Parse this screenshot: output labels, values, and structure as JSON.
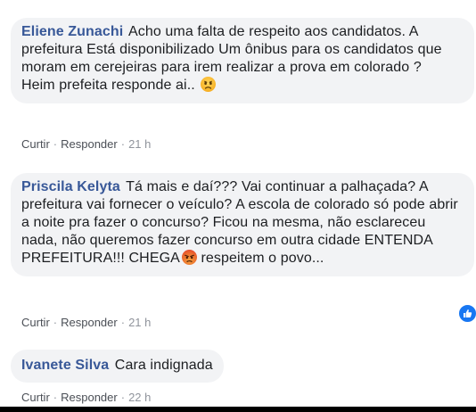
{
  "comments": [
    {
      "author": "Eliene Zunachi",
      "text": "Acho uma falta de respeito aos candidatos. A prefeitura Está disponibilizado Um ônibus para os candidatos que moram em cerejeiras para irem realizar a prova em colorado ?\nHeim prefeita responde ai..",
      "emoji": "sad-face-icon",
      "actions": {
        "reply_label": "Curtir",
        "respond_label": "Responder",
        "time": "21 h"
      }
    },
    {
      "author": "Priscila Kelyta",
      "text_before_emoji": "Tá mais e daí??? Vai continuar a palhaçada? A prefeitura vai fornecer o veículo? A escola de colorado só pode abrir a noite pra fazer o concurso? Ficou na mesma, não esclareceu nada, não queremos fazer concurso em outra cidade ENTENDA PREFEITURA!!! CHEGA",
      "text_after_emoji": " respeitem o povo...",
      "emoji": "angry-face-icon",
      "actions": {
        "reply_label": "Curtir",
        "respond_label": "Responder",
        "time": "21 h"
      }
    },
    {
      "author": "Ivanete Silva",
      "text": "Cara indignada",
      "actions": {
        "reply_label": "Curtir",
        "respond_label": "Responder",
        "time": "22 h"
      }
    }
  ],
  "reaction_badge": {
    "icon": "like-icon",
    "color": "#1877f2"
  },
  "separator": "·"
}
